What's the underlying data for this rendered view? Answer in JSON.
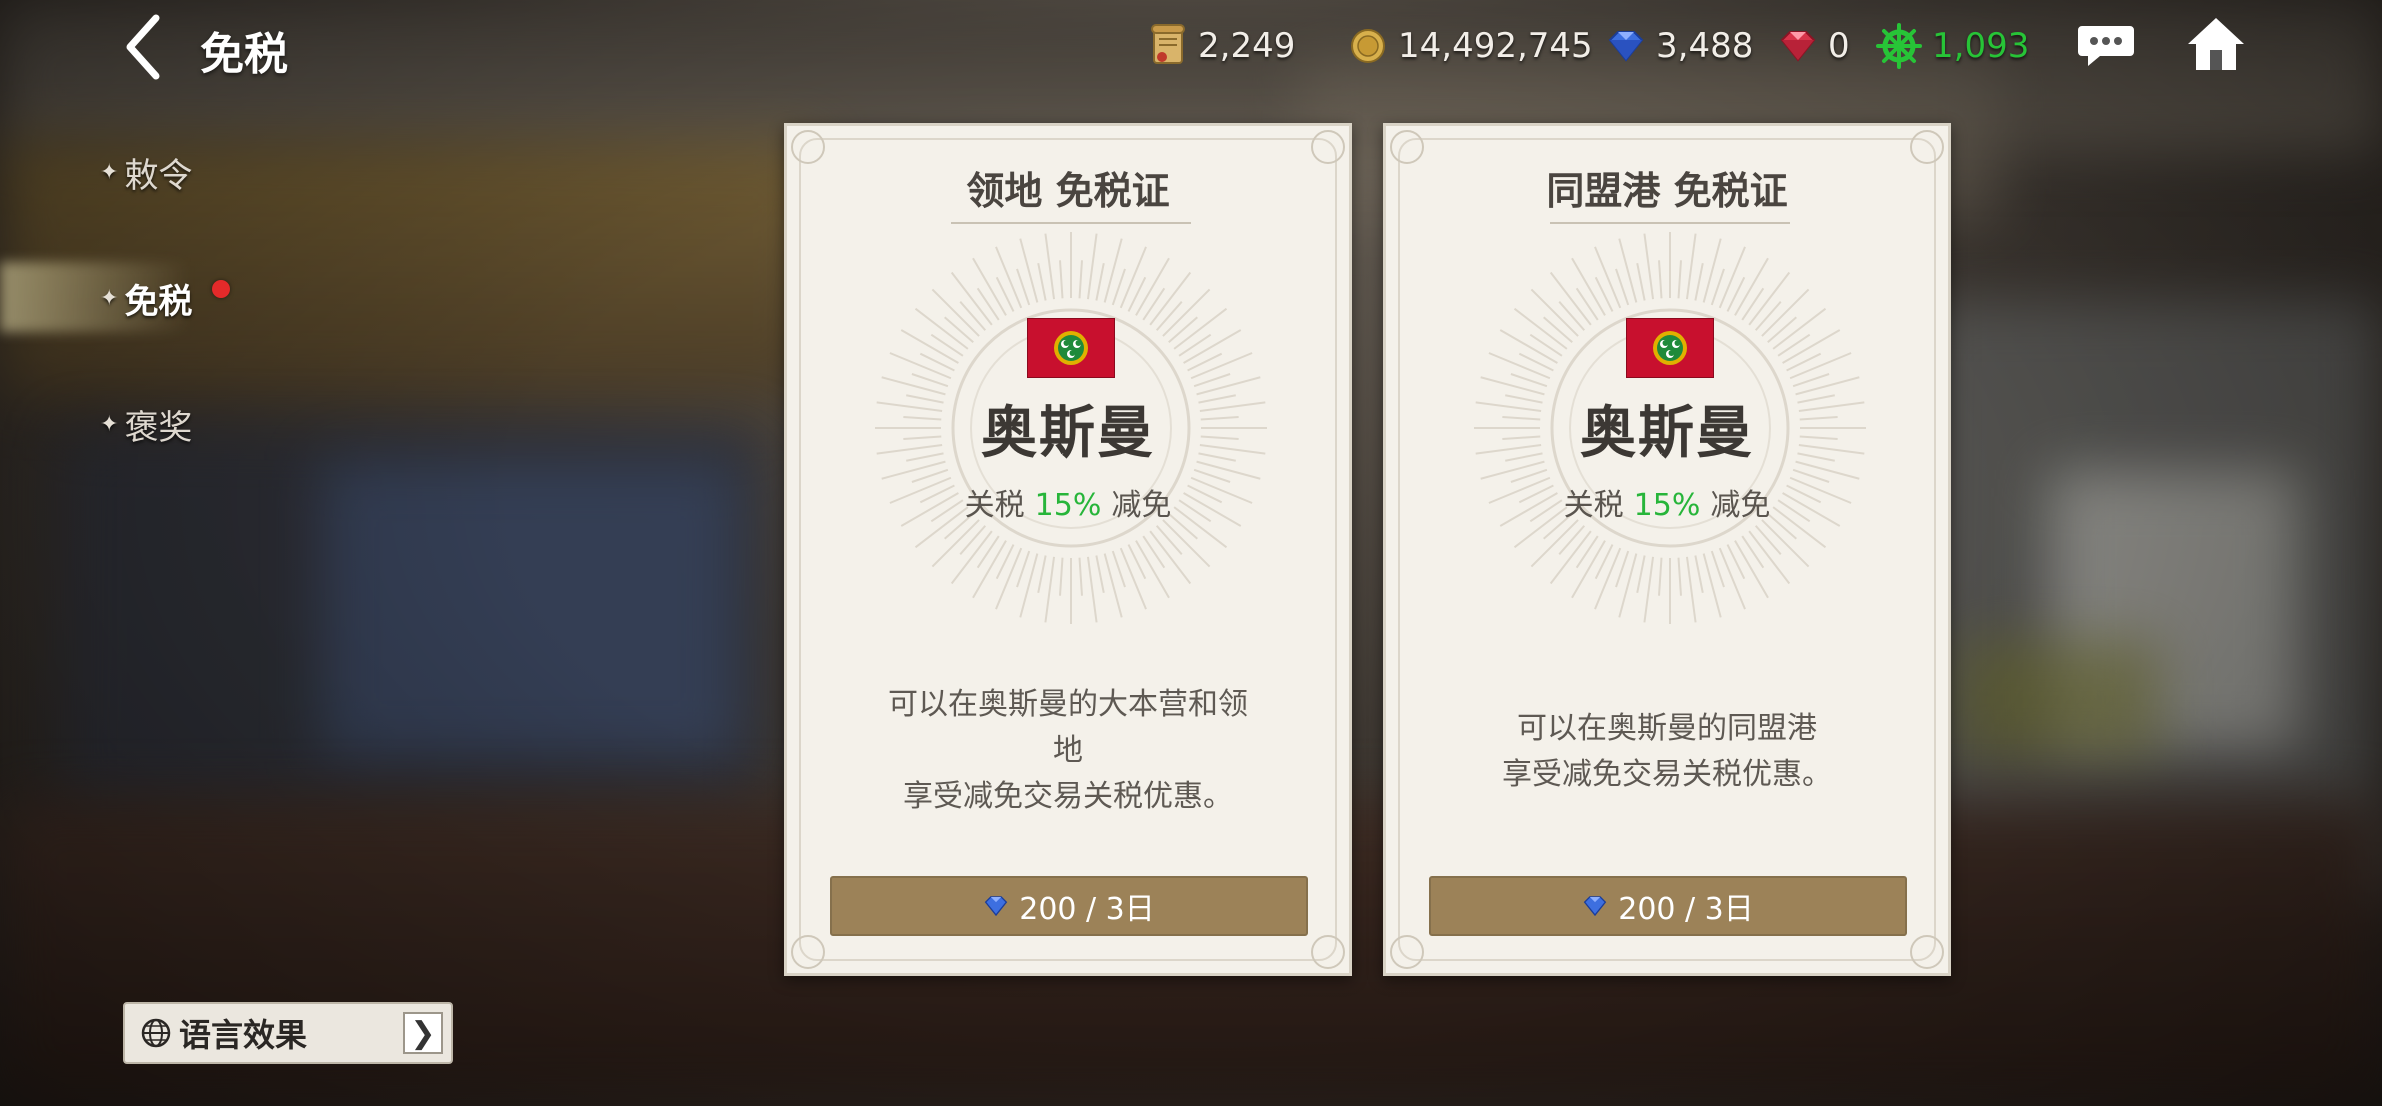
{
  "header": {
    "title": "免税",
    "resources": [
      {
        "icon": "scroll-icon",
        "value": "2,249"
      },
      {
        "icon": "gold-coin-icon",
        "value": "14,492,745"
      },
      {
        "icon": "blue-gem-icon",
        "value": "3,488"
      },
      {
        "icon": "red-gem-icon",
        "value": "0"
      },
      {
        "icon": "ship-wheel-icon",
        "value": "1,093",
        "color": "#27c437"
      }
    ]
  },
  "sidebar": {
    "items": [
      {
        "label": "敕令",
        "active": false
      },
      {
        "label": "免税",
        "active": true,
        "notification": true
      },
      {
        "label": "褒奖",
        "active": false
      }
    ]
  },
  "cards": [
    {
      "title": "领地 免税证",
      "nation": "奥斯曼",
      "duty_prefix": "关税",
      "duty_pct": "15%",
      "duty_suffix": "减免",
      "desc_lines": [
        "可以在奥斯曼的大本营和领",
        "地",
        "享受减免交易关税优惠。"
      ],
      "price": "200 / 3日"
    },
    {
      "title": "同盟港 免税证",
      "nation": "奥斯曼",
      "duty_prefix": "关税",
      "duty_pct": "15%",
      "duty_suffix": "减免",
      "desc_lines": [
        "可以在奥斯曼的同盟港",
        "享受减免交易关税优惠。"
      ],
      "price": "200 / 3日"
    }
  ],
  "language_button": {
    "label": "语言效果",
    "arrow": "❯"
  },
  "colors": {
    "accent_green": "#27b53a",
    "buy_button": "#9c8258",
    "flag_red": "#c8102e"
  }
}
